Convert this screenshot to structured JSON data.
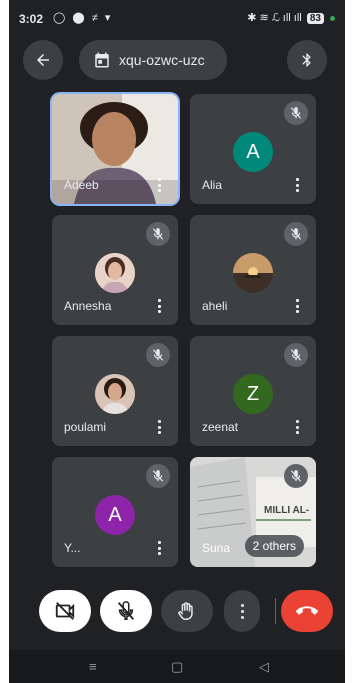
{
  "status_bar": {
    "time": "3:02",
    "left_icons": "◯ ⬤ ≠ ▾",
    "right_icons": "✱ ≋ ℒ ıll ıll",
    "battery": "83"
  },
  "header": {
    "meeting_code": "xqu-ozwc-uzc"
  },
  "participants": [
    {
      "name": "Adeeb",
      "initial": "",
      "avatar_color": "#c9a27a",
      "type": "video"
    },
    {
      "name": "Alia",
      "initial": "A",
      "avatar_color": "#00897b",
      "type": "letter"
    },
    {
      "name": "Annesha",
      "initial": "",
      "avatar_color": "#d7b5a6",
      "type": "photo"
    },
    {
      "name": "aheli",
      "initial": "",
      "avatar_color": "#7d5a3c",
      "type": "photo"
    },
    {
      "name": "poulami",
      "initial": "",
      "avatar_color": "#b68f7a",
      "type": "photo"
    },
    {
      "name": "zeenat",
      "initial": "Z",
      "avatar_color": "#33691e",
      "type": "letter"
    },
    {
      "name": "Y...",
      "initial": "A",
      "avatar_color": "#8e24aa",
      "type": "letter"
    },
    {
      "name": "Suna",
      "initial": "",
      "avatar_color": "#d8d8d8",
      "type": "video"
    }
  ],
  "others_chip": "2 others",
  "sign_text": "MILLI AL-",
  "colors": {
    "background": "#202124",
    "tile": "#3c4043",
    "end_call": "#ea4335",
    "active_border": "#8ab4f8"
  }
}
